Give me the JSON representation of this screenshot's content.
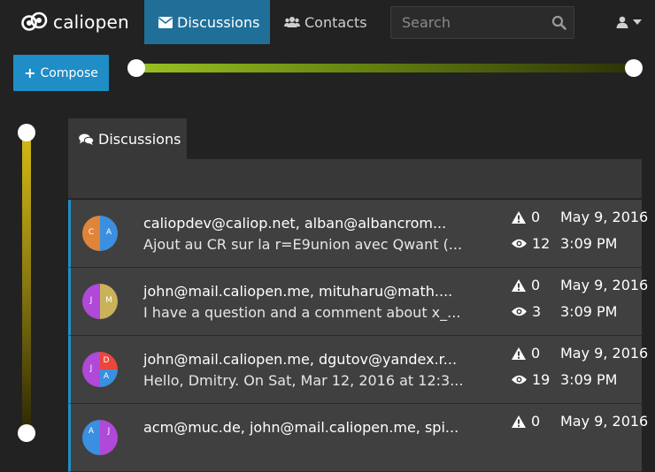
{
  "app": {
    "name": "caliopen"
  },
  "nav": {
    "discussions_label": "Discussions",
    "contacts_label": "Contacts"
  },
  "search": {
    "placeholder": "Search",
    "value": ""
  },
  "compose": {
    "plus": "+",
    "label": "Compose"
  },
  "panel": {
    "tab_label": "Discussions"
  },
  "colors": {
    "accent": "#1f8dc6",
    "nav_active": "#1f6f99",
    "importance_slider": "#99c222",
    "privacy_slider": "#d4bb16"
  },
  "discussions": [
    {
      "participants": "caliopdev@caliop.net, alban@albancrom...",
      "excerpt": "Ajout au CR sur la r=E9union avec Qwant (...",
      "alerts": "0",
      "views": "12",
      "date": "May 9, 2016",
      "time": "3:09 PM",
      "avatar": {
        "letters": [
          "C",
          "A"
        ],
        "colors": [
          "#e0843a",
          "#3b8fe0"
        ]
      }
    },
    {
      "participants": "john@mail.caliopen.me, mituharu@math....",
      "excerpt": "I have a question and a comment about x_...",
      "alerts": "0",
      "views": "3",
      "date": "May 9, 2016",
      "time": "3:09 PM",
      "avatar": {
        "letters": [
          "J",
          "M"
        ],
        "colors": [
          "#b048d8",
          "#c9b25a"
        ]
      }
    },
    {
      "participants": "john@mail.caliopen.me, dgutov@yandex.r...",
      "excerpt": "Hello, Dmitry. On Sat, Mar 12, 2016 at 12:3...",
      "alerts": "0",
      "views": "19",
      "date": "May 9, 2016",
      "time": "3:09 PM",
      "avatar": {
        "letters": [
          "J",
          "D",
          "A"
        ],
        "colors": [
          "#b048d8",
          "#e8473a",
          "#3b8fe0"
        ]
      }
    },
    {
      "participants": "acm@muc.de, john@mail.caliopen.me, spi...",
      "excerpt": "",
      "alerts": "0",
      "views": "",
      "date": "May 9, 2016",
      "time": "",
      "avatar": {
        "letters": [
          "A",
          "J"
        ],
        "colors": [
          "#3b8fe0",
          "#b048d8"
        ]
      }
    }
  ]
}
